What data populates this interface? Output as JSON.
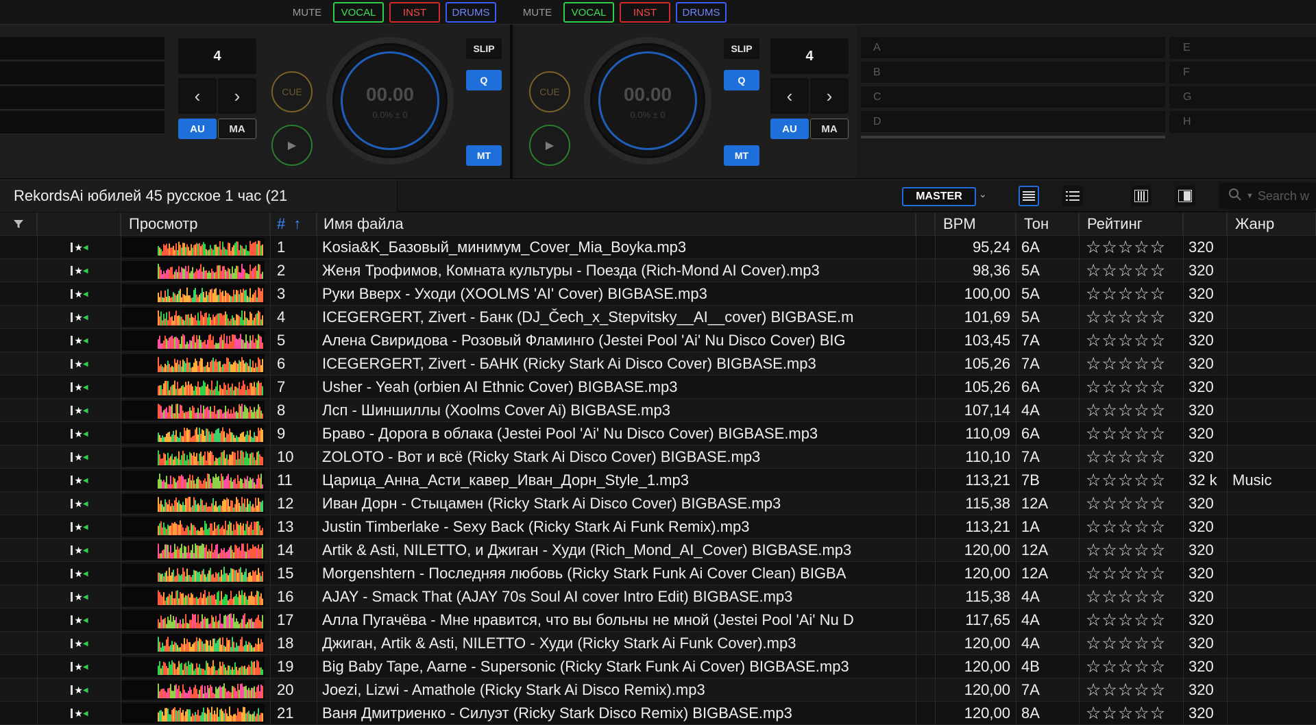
{
  "stem_bar": {
    "groups": [
      {
        "mute": "MUTE",
        "vocal": "VOCAL",
        "inst": "INST",
        "drums": "DRUMS"
      },
      {
        "mute": "MUTE",
        "vocal": "VOCAL",
        "inst": "INST",
        "drums": "DRUMS"
      }
    ]
  },
  "decks": {
    "left": {
      "beat_jump": "4",
      "prev": "‹",
      "next": "›",
      "au": "AU",
      "ma": "MA",
      "cue": "CUE",
      "play": "▶",
      "time": "00.00",
      "pitch": "0.0% ± 0",
      "slip": "SLIP",
      "q": "Q",
      "mt": "MT"
    },
    "right": {
      "beat_jump": "4",
      "prev": "‹",
      "next": "›",
      "au": "AU",
      "ma": "MA",
      "cue": "CUE",
      "play": "▶",
      "time": "00.00",
      "pitch": "0.0% ± 0",
      "slip": "SLIP",
      "q": "Q",
      "mt": "MT"
    }
  },
  "hot_cues": {
    "left": [
      "A",
      "B",
      "C",
      "D"
    ],
    "right": [
      "E",
      "F",
      "G",
      "H"
    ]
  },
  "browser": {
    "playlist_title": "RekordsAi юбилей 45 русское 1 час (21",
    "master_label": "MASTER",
    "search_placeholder": "Search w"
  },
  "table": {
    "headers": {
      "preview": "Просмотр",
      "number": "#",
      "filename": "Имя файла",
      "bpm": "BPM",
      "key": "Тон",
      "rating": "Рейтинг",
      "genre": "Жанр"
    },
    "rows": [
      {
        "num": "1",
        "name": "Kosia&K_Базовый_минимум_Cover_Mia_Boyka.mp3",
        "bpm": "95,24",
        "key": "6A",
        "rating": "☆☆☆☆☆",
        "bitrate": "320",
        "genre": ""
      },
      {
        "num": "2",
        "name": "Женя Трофимов, Комната культуры - Поезда (Rich-Mond AI Cover).mp3",
        "bpm": "98,36",
        "key": "5A",
        "rating": "☆☆☆☆☆",
        "bitrate": "320",
        "genre": ""
      },
      {
        "num": "3",
        "name": "Руки Вверх - Уходи (XOOLMS 'AI' Cover) BIGBASE.mp3",
        "bpm": "100,00",
        "key": "5A",
        "rating": "☆☆☆☆☆",
        "bitrate": "320",
        "genre": ""
      },
      {
        "num": "4",
        "name": "ICEGERGERT, Zivert - Банк (DJ_Čech_x_Stepvitsky__AI__cover) BIGBASE.m",
        "bpm": "101,69",
        "key": "5A",
        "rating": "☆☆☆☆☆",
        "bitrate": "320",
        "genre": ""
      },
      {
        "num": "5",
        "name": "Алена Свиридова - Розовый Фламинго (Jestei Pool 'Ai' Nu Disco Cover) BIG",
        "bpm": "103,45",
        "key": "7A",
        "rating": "☆☆☆☆☆",
        "bitrate": "320",
        "genre": ""
      },
      {
        "num": "6",
        "name": "ICEGERGERT, Zivert - БАНК (Ricky Stark Ai Disco Cover) BIGBASE.mp3",
        "bpm": "105,26",
        "key": "7A",
        "rating": "☆☆☆☆☆",
        "bitrate": "320",
        "genre": ""
      },
      {
        "num": "7",
        "name": "Usher - Yeah (orbien AI Ethnic Cover) BIGBASE.mp3",
        "bpm": "105,26",
        "key": "6A",
        "rating": "☆☆☆☆☆",
        "bitrate": "320",
        "genre": ""
      },
      {
        "num": "8",
        "name": "Лсп - Шиншиллы (Xoolms Cover Ai) BIGBASE.mp3",
        "bpm": "107,14",
        "key": "4A",
        "rating": "☆☆☆☆☆",
        "bitrate": "320",
        "genre": ""
      },
      {
        "num": "9",
        "name": "Браво - Дорога в облака (Jestei Pool 'Ai' Nu Disco Cover) BIGBASE.mp3",
        "bpm": "110,09",
        "key": "6A",
        "rating": "☆☆☆☆☆",
        "bitrate": "320",
        "genre": ""
      },
      {
        "num": "10",
        "name": "ZOLOTO - Вот и всё (Ricky Stark Ai Disco Cover) BIGBASE.mp3",
        "bpm": "110,10",
        "key": "7A",
        "rating": "☆☆☆☆☆",
        "bitrate": "320",
        "genre": ""
      },
      {
        "num": "11",
        "name": "Царица_Анна_Асти_кавер_Иван_Дорн_Style_1.mp3",
        "bpm": "113,21",
        "key": "7B",
        "rating": "☆☆☆☆☆",
        "bitrate": "32 k",
        "genre": "Music"
      },
      {
        "num": "12",
        "name": "Иван Дорн - Стыцамен (Ricky Stark Ai Disco Cover) BIGBASE.mp3",
        "bpm": "115,38",
        "key": "12A",
        "rating": "☆☆☆☆☆",
        "bitrate": "320",
        "genre": ""
      },
      {
        "num": "13",
        "name": "Justin Timberlake - Sexy Back (Ricky Stark Ai Funk Remix).mp3",
        "bpm": "113,21",
        "key": "1A",
        "rating": "☆☆☆☆☆",
        "bitrate": "320",
        "genre": ""
      },
      {
        "num": "14",
        "name": "Artik & Asti, NILETTO, и Джиган - Худи (Rich_Mond_AI_Cover) BIGBASE.mp3",
        "bpm": "120,00",
        "key": "12A",
        "rating": "☆☆☆☆☆",
        "bitrate": "320",
        "genre": ""
      },
      {
        "num": "15",
        "name": "Morgenshtern -  Последняя любовь (Ricky Stark Funk Ai Cover Clean) BIGBA",
        "bpm": "120,00",
        "key": "12A",
        "rating": "☆☆☆☆☆",
        "bitrate": "320",
        "genre": ""
      },
      {
        "num": "16",
        "name": "AJAY - Smack That (AJAY 70s Soul AI cover Intro Edit) BIGBASE.mp3",
        "bpm": "115,38",
        "key": "4A",
        "rating": "☆☆☆☆☆",
        "bitrate": "320",
        "genre": ""
      },
      {
        "num": "17",
        "name": "Алла Пугачёва - Мне нравится, что вы больны не мной (Jestei Pool 'Ai' Nu D",
        "bpm": "117,65",
        "key": "4A",
        "rating": "☆☆☆☆☆",
        "bitrate": "320",
        "genre": ""
      },
      {
        "num": "18",
        "name": "Джиган, Artik & Asti, NILETTO - Худи (Ricky Stark Ai Funk Cover).mp3",
        "bpm": "120,00",
        "key": "4A",
        "rating": "☆☆☆☆☆",
        "bitrate": "320",
        "genre": ""
      },
      {
        "num": "19",
        "name": "Big Baby Tape, Aarne - Supersonic (Ricky Stark Funk Ai Cover) BIGBASE.mp3",
        "bpm": "120,00",
        "key": "4B",
        "rating": "☆☆☆☆☆",
        "bitrate": "320",
        "genre": ""
      },
      {
        "num": "20",
        "name": "Joezi, Lizwi - Amathole (Ricky Stark Ai Disco Remix).mp3",
        "bpm": "120,00",
        "key": "7A",
        "rating": "☆☆☆☆☆",
        "bitrate": "320",
        "genre": ""
      },
      {
        "num": "21",
        "name": "Ваня Дмитриенко - Силуэт (Ricky Stark Disco Remix) BIGBASE.mp3",
        "bpm": "120,00",
        "key": "8A",
        "rating": "☆☆☆☆☆",
        "bitrate": "320",
        "genre": ""
      }
    ]
  },
  "colors": {
    "accent_blue": "#1e6fd9",
    "vocal_green": "#2fd14a",
    "inst_red": "#d02a2a",
    "drums_blue": "#3b5bff",
    "cue_gold": "#7a6128"
  },
  "icons": [
    "filter-icon",
    "sort-up-icon",
    "search-icon",
    "list-view-icon",
    "detail-view-icon",
    "column-view-icon",
    "panel-view-icon",
    "chevron-down-icon"
  ]
}
